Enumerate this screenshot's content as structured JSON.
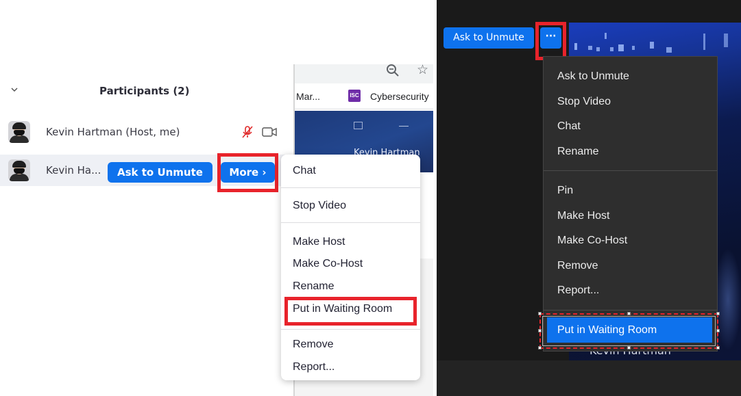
{
  "left": {
    "participants_title": "Participants (2)",
    "host_name": "Kevin Hartman (Host, me)",
    "guest_name": "Kevin Ha...",
    "ask_unmute_label": "Ask to Unmute",
    "more_label": "More ›",
    "browser": {
      "bookmark_1": "Mar...",
      "bookmark_2": "Cybersecurity",
      "video_name": "Kevin Hartman"
    },
    "menu_items": [
      "Chat",
      "Stop Video",
      "Make Host",
      "Make Co-Host",
      "Rename",
      "Put in Waiting Room",
      "Remove",
      "Report..."
    ]
  },
  "right": {
    "ask_unmute_label": "Ask to Unmute",
    "dots_label": "···",
    "video_name": "Kevin Hartman",
    "menu_items": [
      "Ask to Unmute",
      "Stop Video",
      "Chat",
      "Rename",
      "Pin",
      "Make Host",
      "Make Co-Host",
      "Remove",
      "Report...",
      "Put in Waiting Room"
    ]
  },
  "colors": {
    "accent_blue": "#0e72ed",
    "highlight_red": "#e8232b",
    "dark_menu_bg": "#2e2e2e"
  }
}
